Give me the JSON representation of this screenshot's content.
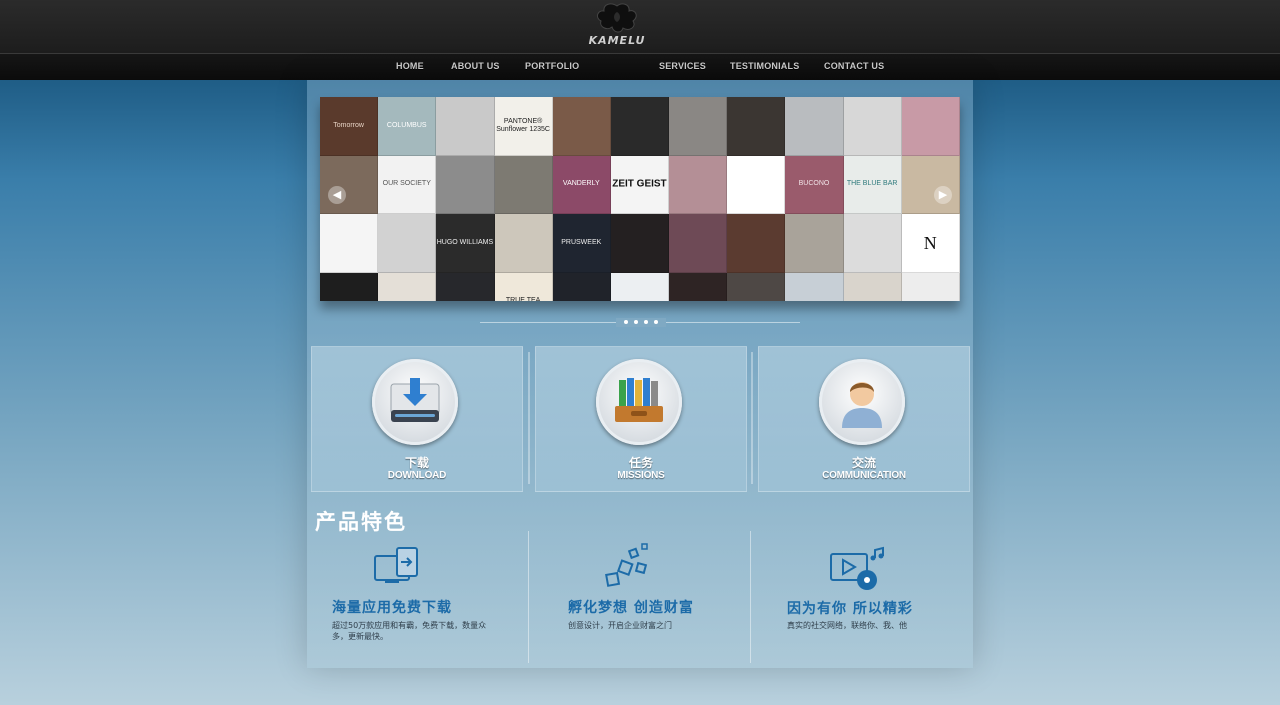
{
  "brand": {
    "logo_text": "KAMELU"
  },
  "nav": {
    "items": [
      "HOME",
      "ABOUT US",
      "PORTFOLIO",
      "SERVICES",
      "TESTIMONIALS",
      "CONTACT US"
    ]
  },
  "gallery": {
    "tiles": [
      {
        "bg": "#5a3a2c",
        "text": "Tomorrow",
        "color": "#e6d2c4"
      },
      {
        "bg": "#a4b9bd",
        "text": "COLUMBUS",
        "color": "#ffffff"
      },
      {
        "bg": "#c9c9c9",
        "text": "",
        "color": "#333"
      },
      {
        "bg": "#f2f0ea",
        "text": "PANTONE® Sunflower 1235C",
        "color": "#222"
      },
      {
        "bg": "#7a5a48",
        "text": "",
        "color": "#fff"
      },
      {
        "bg": "#2a2a2a",
        "text": "",
        "color": "#fff"
      },
      {
        "bg": "#8a8784",
        "text": "",
        "color": "#fff"
      },
      {
        "bg": "#3b3632",
        "text": "",
        "color": "#fff"
      },
      {
        "bg": "#b9bcbf",
        "text": "",
        "color": "#222"
      },
      {
        "bg": "#d7d7d7",
        "text": "",
        "color": "#222"
      },
      {
        "bg": "#c89aa6",
        "text": "",
        "color": "#fff"
      },
      {
        "bg": "#7c6a5c",
        "text": "",
        "color": "#fff"
      },
      {
        "bg": "#f2f2f2",
        "text": "OUR SOCIETY",
        "color": "#555"
      },
      {
        "bg": "#8c8c8c",
        "text": "",
        "color": "#fff"
      },
      {
        "bg": "#7d7a72",
        "text": "",
        "color": "#fff"
      },
      {
        "bg": "#8c4a68",
        "text": "VANDERLY",
        "color": "#ffffff"
      },
      {
        "bg": "#f4f4f4",
        "text": "ZEIT GEIST",
        "color": "#111"
      },
      {
        "bg": "#b48f96",
        "text": "",
        "color": "#fff"
      },
      {
        "bg": "#ffffff",
        "text": "",
        "color": "#111"
      },
      {
        "bg": "#9a5b6c",
        "text": "BUCONO",
        "color": "#f1e3e7"
      },
      {
        "bg": "#e8ecea",
        "text": "THE BLUE BAR",
        "color": "#2f7b7d"
      },
      {
        "bg": "#c9b9a2",
        "text": "",
        "color": "#fff"
      },
      {
        "bg": "#f5f5f5",
        "text": "",
        "color": "#333"
      },
      {
        "bg": "#d2d2d2",
        "text": "",
        "color": "#555"
      },
      {
        "bg": "#2b2b2b",
        "text": "HUGO WILLIAMS",
        "color": "#eee"
      },
      {
        "bg": "#cdc7bb",
        "text": "",
        "color": "#333"
      },
      {
        "bg": "#1f2530",
        "text": "PRUSWEEK",
        "color": "#eee"
      },
      {
        "bg": "#242021",
        "text": "",
        "color": "#fff"
      },
      {
        "bg": "#6e4a56",
        "text": "",
        "color": "#eee"
      },
      {
        "bg": "#5b3b30",
        "text": "",
        "color": "#fff"
      },
      {
        "bg": "#a9a39a",
        "text": "",
        "color": "#fff"
      },
      {
        "bg": "#dcdcdc",
        "text": "",
        "color": "#555"
      },
      {
        "bg": "#ffffff",
        "text": "N",
        "color": "#111"
      },
      {
        "bg": "#1e1e1e",
        "text": "",
        "color": "#eee"
      },
      {
        "bg": "#e4dfd7",
        "text": "",
        "color": "#333"
      },
      {
        "bg": "#27282c",
        "text": "",
        "color": "#eee"
      },
      {
        "bg": "#efe8da",
        "text": "TRUE TEA",
        "color": "#222"
      },
      {
        "bg": "#20232a",
        "text": "",
        "color": "#eee"
      },
      {
        "bg": "#eceff2",
        "text": "",
        "color": "#333"
      },
      {
        "bg": "#2e2424",
        "text": "",
        "color": "#eee"
      },
      {
        "bg": "#4e4845",
        "text": "",
        "color": "#eee"
      },
      {
        "bg": "#c7cfd6",
        "text": "",
        "color": "#333"
      },
      {
        "bg": "#d9d4cc",
        "text": "",
        "color": "#333"
      },
      {
        "bg": "#ededed",
        "text": "",
        "color": "#333"
      }
    ]
  },
  "boxes": [
    {
      "cn": "下载",
      "en": "DOWNLOAD",
      "icon": "download-drive-icon"
    },
    {
      "cn": "任务",
      "en": "MISSIONS",
      "icon": "binders-tray-icon"
    },
    {
      "cn": "交流",
      "en": "COMMUNICATION",
      "icon": "user-person-icon"
    }
  ],
  "features": {
    "title": "产品特色",
    "items": [
      {
        "title": "海量应用免费下载",
        "desc": "超过50万款应用和有霸，免费下载，数量众多，更新最快。",
        "icon": "devices-sync-icon"
      },
      {
        "title": "孵化梦想 创造财富",
        "desc": "创意设计，开启企业财富之门",
        "icon": "floating-squares-icon"
      },
      {
        "title": "因为有你 所以精彩",
        "desc": "真实的社交网络，联络你、我、他",
        "icon": "media-player-icon"
      }
    ]
  },
  "colors": {
    "feature_title": "#1c6ba8",
    "header_bg": "#1f1f1f"
  }
}
